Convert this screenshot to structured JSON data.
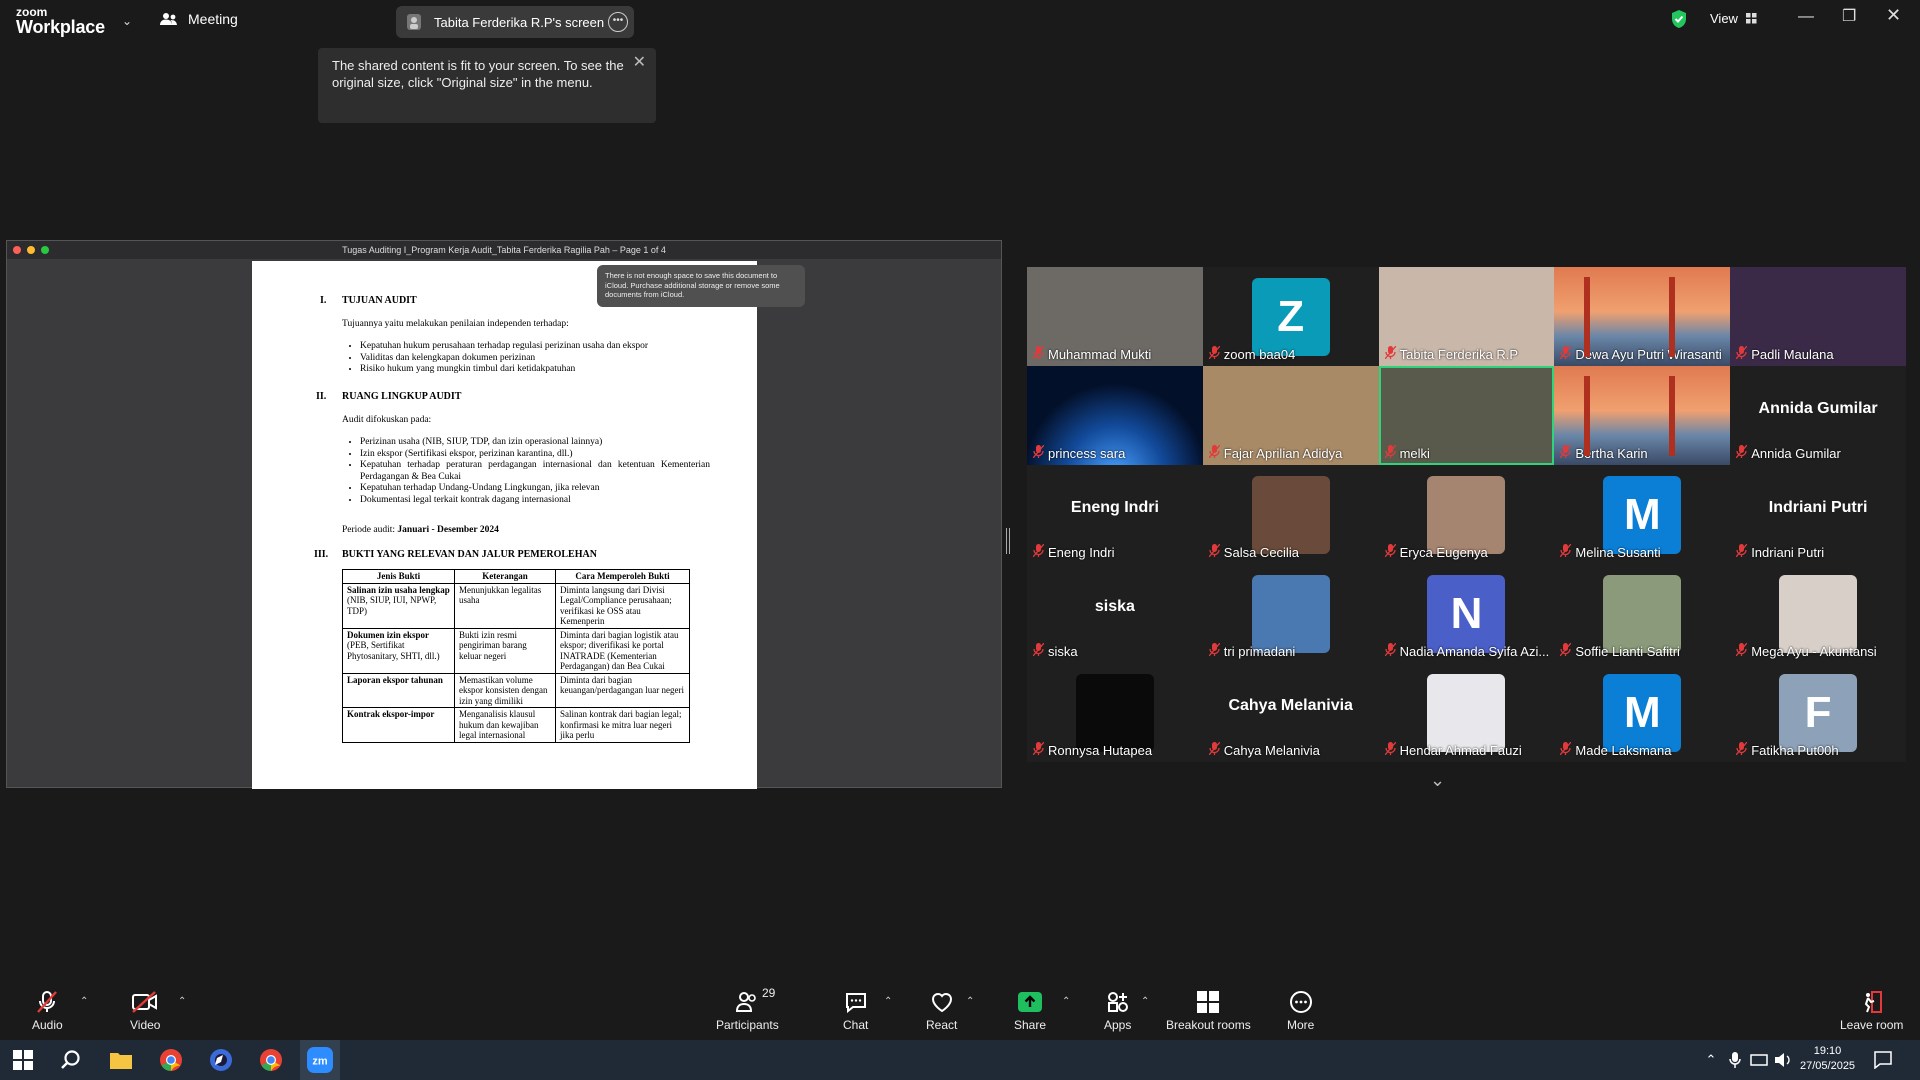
{
  "topbar": {
    "logo_line1": "zoom",
    "logo_line2": "Workplace",
    "meeting_label": "Meeting",
    "share_title": "Tabita Ferderika R.P's screen",
    "view_label": "View",
    "tooltip_text": "The shared content is fit to your screen. To see the original size, click \"Original size\" in the menu."
  },
  "doc": {
    "window_title": "Tugas Auditing I_Program Kerja Audit_Tabita Ferderika Ragilia Pah – Page 1 of 4",
    "icloud_msg": "There is not enough space to save this document to iCloud. Purchase additional storage or remove some documents from iCloud.",
    "sec1_num": "I.",
    "sec1_title": "TUJUAN AUDIT",
    "sec1_intro": "Tujuannya yaitu melakukan penilaian independen terhadap:",
    "sec1_items": [
      "Kepatuhan hukum perusahaan terhadap regulasi perizinan usaha dan ekspor",
      "Validitas dan kelengkapan dokumen perizinan",
      "Risiko hukum yang mungkin timbul dari ketidakpatuhan"
    ],
    "sec2_num": "II.",
    "sec2_title": "RUANG LINGKUP AUDIT",
    "sec2_intro": "Audit difokuskan pada:",
    "sec2_items": [
      "Perizinan usaha (NIB, SIUP, TDP, dan izin operasional lainnya)",
      "Izin ekspor (Sertifikasi ekspor, perizinan karantina, dll.)",
      "Kepatuhan terhadap peraturan perdagangan internasional dan ketentuan Kementerian Perdagangan & Bea Cukai",
      "Kepatuhan terhadap Undang-Undang Lingkungan, jika relevan",
      "Dokumentasi legal terkait kontrak dagang internasional"
    ],
    "period_label": "Periode audit: ",
    "period_value": "Januari - Desember 2024",
    "sec3_num": "III.",
    "sec3_title": "BUKTI YANG RELEVAN DAN JALUR PEMEROLEHAN",
    "table_headers": [
      "Jenis Bukti",
      "Keterangan",
      "Cara Memperoleh Bukti"
    ],
    "table_rows": [
      [
        "Salinan izin usaha lengkap",
        " (NIB, SIUP, IUI, NPWP, TDP)",
        "Menunjukkan legalitas usaha",
        "Diminta langsung dari Divisi Legal/Compliance perusahaan; verifikasi ke OSS atau Kemenperin"
      ],
      [
        "Dokumen izin ekspor",
        " (PEB, Sertifikat Phytosanitary, SHTI, dll.)",
        "Bukti izin resmi pengiriman barang keluar negeri",
        "Diminta dari bagian logistik atau ekspor; diverifikasi ke portal INATRADE (Kementerian Perdagangan) dan Bea Cukai"
      ],
      [
        "Laporan ekspor tahunan",
        "",
        "Memastikan volume ekspor konsisten dengan izin yang dimiliki",
        "Diminta dari bagian keuangan/perdagangan luar negeri"
      ],
      [
        "Kontrak ekspor-impor",
        "",
        "Menganalisis klausul hukum dan kewajiban legal internasional",
        "Salinan kontrak dari bagian legal; konfirmasi ke mitra luar negeri jika perlu"
      ]
    ]
  },
  "participants": [
    {
      "name": "Muhammad Mukti",
      "type": "video",
      "bg": "#6d6a66"
    },
    {
      "name": "zoom baa04",
      "type": "avatar",
      "letter": "Z",
      "color": "#0a9bb8"
    },
    {
      "name": "Tabita Ferderika R.P",
      "type": "video",
      "bg": "#c9b7a9"
    },
    {
      "name": "Dewa Ayu Putri Wirasanti",
      "type": "gg"
    },
    {
      "name": "Padli Maulana",
      "type": "video",
      "bg": "#3a2a48"
    },
    {
      "name": "princess sara",
      "type": "space"
    },
    {
      "name": "Fajar Aprilian Adidya",
      "type": "video",
      "bg": "#a88a66"
    },
    {
      "name": "melki",
      "type": "video",
      "bg": "#5a5a4c",
      "active": true
    },
    {
      "name": "Bertha Karin",
      "type": "gg"
    },
    {
      "name": "Annida Gumilar",
      "type": "text"
    },
    {
      "name": "Eneng Indri",
      "type": "text"
    },
    {
      "name": "Salsa Cecilia",
      "type": "photo",
      "color": "#6a4a3a"
    },
    {
      "name": "Eryca Eugenya",
      "type": "photo",
      "color": "#a58470"
    },
    {
      "name": "Melina Susanti",
      "type": "avatar",
      "letter": "M",
      "color": "#0b7ed6"
    },
    {
      "name": "Indriani Putri",
      "type": "text"
    },
    {
      "name": "siska",
      "type": "text"
    },
    {
      "name": "tri primadani",
      "type": "photo",
      "color": "#4a78b0"
    },
    {
      "name": "Nadia Amanda Syifa Azi...",
      "type": "avatar",
      "letter": "N",
      "color": "#4a5fc8"
    },
    {
      "name": "Soffie Lianti Safitri",
      "type": "photo",
      "color": "#8a9a7a"
    },
    {
      "name": "Mega Ayu - Akuntansi",
      "type": "photo",
      "color": "#d8cfc8"
    },
    {
      "name": "Ronnysa Hutapea",
      "type": "photo",
      "color": "#0a0a0a"
    },
    {
      "name": "Cahya Melanivia",
      "type": "text"
    },
    {
      "name": "Hendar Ahmad Fauzi",
      "type": "photo",
      "color": "#e8e8ec"
    },
    {
      "name": "Made Laksmana",
      "type": "avatar",
      "letter": "M",
      "color": "#0b7ed6"
    },
    {
      "name": "Fatikha Put00h",
      "type": "avatar",
      "letter": "F",
      "color": "#8da2b8"
    }
  ],
  "toolbar": {
    "audio": "Audio",
    "video": "Video",
    "participants": "Participants",
    "participants_count": "29",
    "chat": "Chat",
    "react": "React",
    "share": "Share",
    "apps": "Apps",
    "breakout": "Breakout rooms",
    "more": "More",
    "leave": "Leave room"
  },
  "taskbar": {
    "time": "19:10",
    "date": "27/05/2025"
  },
  "colors": {
    "share_green": "#1fbf5f",
    "active_border": "#2fd37a",
    "mute_red": "#e23a3a"
  }
}
